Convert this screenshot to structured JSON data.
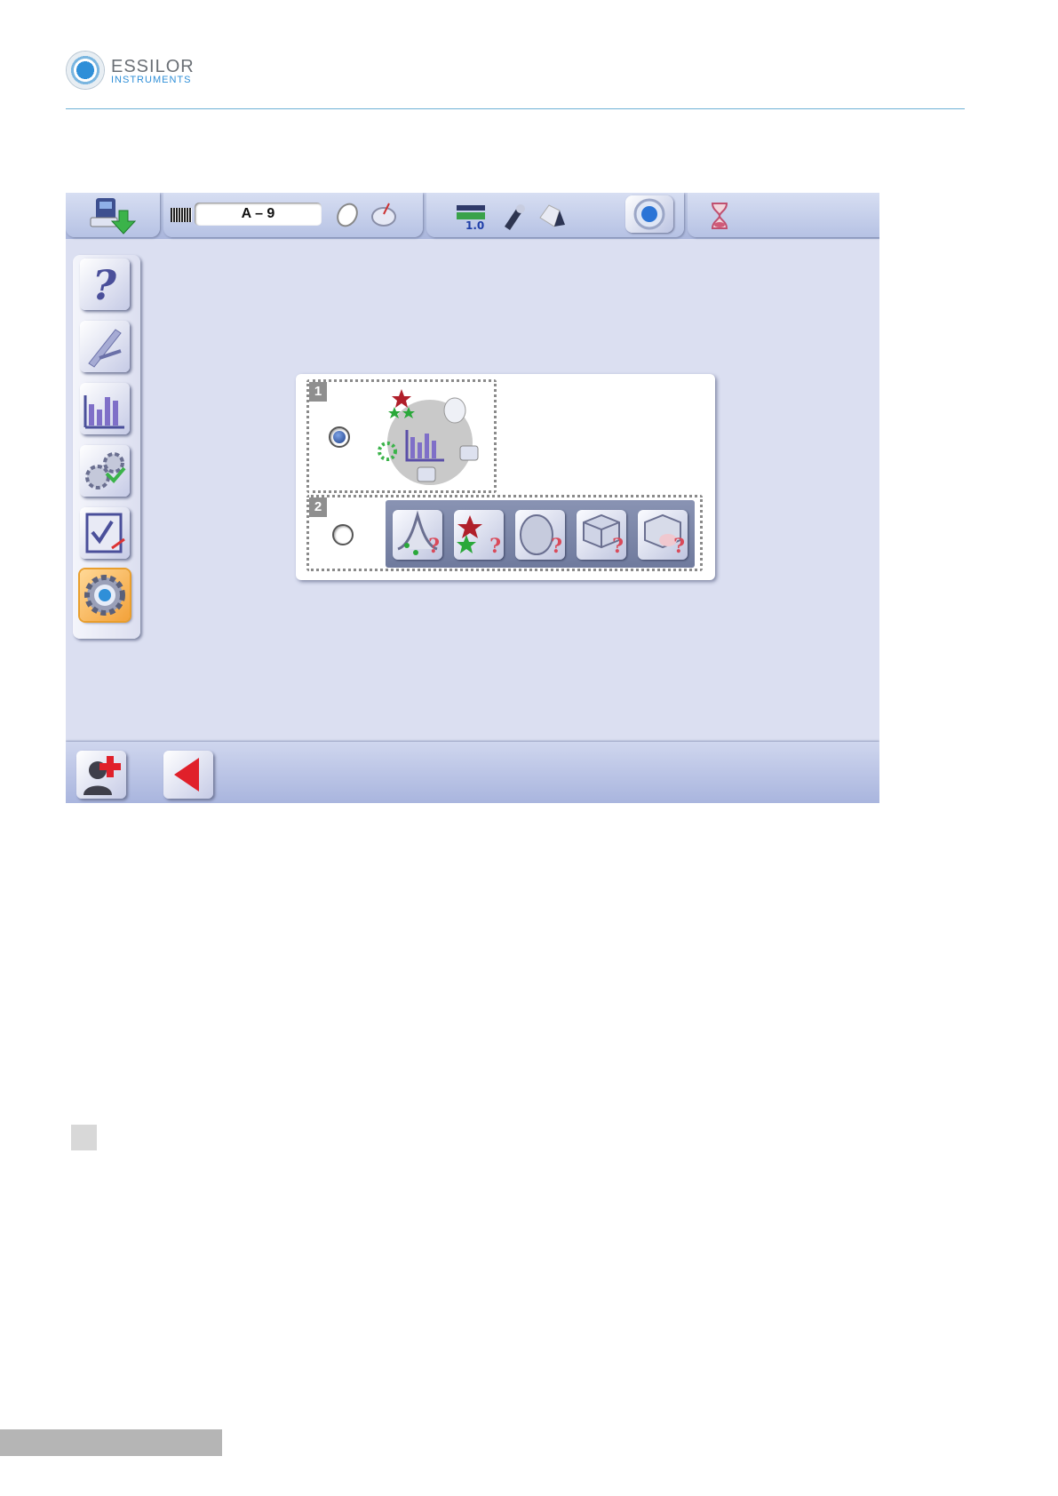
{
  "header": {
    "brand_name": "ESSILOR",
    "brand_sub": "INSTRUMENTS"
  },
  "topbar": {
    "job_number": "A – 9",
    "level_readout": "1.0",
    "icons": [
      "data-download-icon",
      "barcode-icon",
      "lens-frame-icon",
      "lens-shape-icon",
      "level-icon",
      "tool-icon",
      "lens-bevel-icon",
      "tracer-icon",
      "hourglass-icon"
    ]
  },
  "sidebar": {
    "items": [
      "help-icon",
      "calipers-icon",
      "statistics-icon",
      "settings-gears-icon",
      "checklist-icon",
      "preferences-gear-icon"
    ],
    "active": "preferences-gear-icon"
  },
  "dialog": {
    "option1": {
      "number": "1",
      "selected": true
    },
    "option2": {
      "number": "2",
      "selected": false,
      "buttons": [
        "bevel-query-icon",
        "stars-query-icon",
        "shape-query-icon",
        "edge-query-icon",
        "block-query-icon"
      ]
    }
  },
  "bottombar": {
    "buttons": [
      "service-user-icon",
      "back-arrow-icon"
    ]
  },
  "colors": {
    "accent": "#2f8fd8",
    "screen_bg": "#dbdff1",
    "back_red": "#e0202a"
  }
}
